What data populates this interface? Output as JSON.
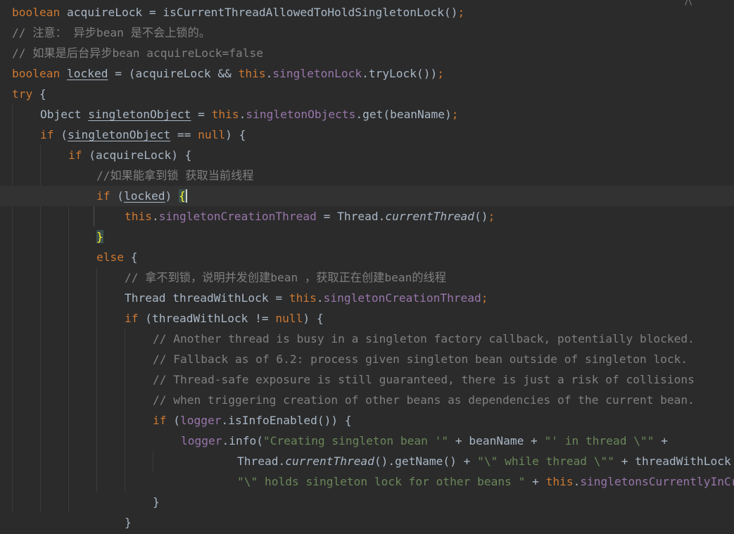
{
  "editor": {
    "lines": [
      [
        [
          "kw",
          "boolean"
        ],
        [
          "p",
          " acquireLock = isCurrentThreadAllowedToHoldSingletonLock()"
        ],
        [
          "kw",
          ";"
        ]
      ],
      [
        [
          "cm",
          "// 注意： 异步bean 是不会上锁的。"
        ]
      ],
      [
        [
          "cm",
          "// 如果是后台异步bean acquireLock=false"
        ]
      ],
      [
        [
          "kw",
          "boolean"
        ],
        [
          "p",
          " "
        ],
        [
          "ul",
          "locked"
        ],
        [
          "p",
          " = (acquireLock && "
        ],
        [
          "kw",
          "this"
        ],
        [
          "p",
          "."
        ],
        [
          "fd",
          "singletonLock"
        ],
        [
          "p",
          ".tryLock())"
        ],
        [
          "kw",
          ";"
        ]
      ],
      [
        [
          "kw",
          "try"
        ],
        [
          "p",
          " {"
        ]
      ],
      [
        [
          "p",
          "Object "
        ],
        [
          "ul",
          "singletonObject"
        ],
        [
          "p",
          " = "
        ],
        [
          "kw",
          "this"
        ],
        [
          "p",
          "."
        ],
        [
          "fd",
          "singletonObjects"
        ],
        [
          "p",
          ".get(beanName)"
        ],
        [
          "kw",
          ";"
        ]
      ],
      [
        [
          "kw",
          "if"
        ],
        [
          "p",
          " ("
        ],
        [
          "ul",
          "singletonObject"
        ],
        [
          "p",
          " == "
        ],
        [
          "kw",
          "null"
        ],
        [
          "p",
          ") {"
        ]
      ],
      [
        [
          "kw",
          "if"
        ],
        [
          "p",
          " (acquireLock) {"
        ]
      ],
      [
        [
          "cm",
          "//如果能拿到锁 获取当前线程"
        ]
      ],
      [
        [
          "kw",
          "if"
        ],
        [
          "p",
          " ("
        ],
        [
          "ul",
          "locked"
        ],
        [
          "p",
          ") "
        ],
        [
          "bhc",
          "{"
        ]
      ],
      [
        [
          "kw",
          "this"
        ],
        [
          "p",
          "."
        ],
        [
          "fd",
          "singletonCreationThread"
        ],
        [
          "p",
          " = Thread."
        ],
        [
          "it",
          "currentThread"
        ],
        [
          "p",
          "()"
        ],
        [
          "kw",
          ";"
        ]
      ],
      [
        [
          "bh",
          "}"
        ]
      ],
      [
        [
          "kw",
          "else"
        ],
        [
          "p",
          " {"
        ]
      ],
      [
        [
          "cm",
          "// 拿不到锁，说明并发创建bean ，获取正在创建bean的线程"
        ]
      ],
      [
        [
          "p",
          "Thread threadWithLock = "
        ],
        [
          "kw",
          "this"
        ],
        [
          "p",
          "."
        ],
        [
          "fd",
          "singletonCreationThread"
        ],
        [
          "kw",
          ";"
        ]
      ],
      [
        [
          "kw",
          "if"
        ],
        [
          "p",
          " (threadWithLock != "
        ],
        [
          "kw",
          "null"
        ],
        [
          "p",
          ") {"
        ]
      ],
      [
        [
          "cm",
          "// Another thread is busy in a singleton factory callback, potentially blocked."
        ]
      ],
      [
        [
          "cm",
          "// Fallback as of 6.2: process given singleton bean outside of singleton lock."
        ]
      ],
      [
        [
          "cm",
          "// Thread-safe exposure is still guaranteed, there is just a risk of collisions"
        ]
      ],
      [
        [
          "cm",
          "// when triggering creation of other beans as dependencies of the current bean."
        ]
      ],
      [
        [
          "kw",
          "if"
        ],
        [
          "p",
          " ("
        ],
        [
          "fd",
          "logger"
        ],
        [
          "p",
          ".isInfoEnabled()) {"
        ]
      ],
      [
        [
          "fd",
          "logger"
        ],
        [
          "p",
          ".info("
        ],
        [
          "st",
          "\"Creating singleton bean '\""
        ],
        [
          "p",
          " + beanName + "
        ],
        [
          "st",
          "\"' in thread \\\"\""
        ],
        [
          "p",
          " +"
        ]
      ],
      [
        [
          "p",
          "Thread."
        ],
        [
          "it",
          "currentThread"
        ],
        [
          "p",
          "().getName() + "
        ],
        [
          "st",
          "\"\\\" while thread \\\"\""
        ],
        [
          "p",
          " + threadWithLock"
        ]
      ],
      [
        [
          "st",
          "\"\\\" holds singleton lock for other beans \""
        ],
        [
          "p",
          " + "
        ],
        [
          "kw",
          "this"
        ],
        [
          "p",
          "."
        ],
        [
          "fd",
          "singletonsCurrentlyInCreation"
        ]
      ],
      [
        [
          "p",
          "}"
        ]
      ],
      [
        [
          "p",
          "}"
        ]
      ]
    ]
  }
}
